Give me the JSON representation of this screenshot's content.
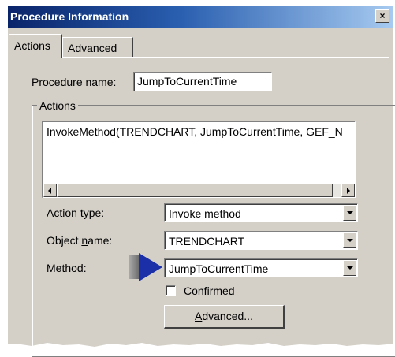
{
  "window": {
    "title": "Procedure Information",
    "close_label": "×"
  },
  "tabs": [
    {
      "label": "Actions",
      "selected": true
    },
    {
      "label": "Advanced",
      "selected": false
    }
  ],
  "procedure": {
    "name_label_prefix": "",
    "name_label_accel": "P",
    "name_label_rest": "rocedure name:",
    "name_value": "JumpToCurrentTime"
  },
  "actions_group": {
    "legend": "Actions",
    "list_items": [
      "InvokeMethod(TRENDCHART, JumpToCurrentTime, GEF_N"
    ]
  },
  "action_type": {
    "label_pre": "Action ",
    "label_accel": "t",
    "label_post": "ype:",
    "value": "Invoke method"
  },
  "object_name": {
    "label_pre": "Object ",
    "label_accel": "n",
    "label_post": "ame:",
    "value": "TRENDCHART"
  },
  "method": {
    "label_pre": "Met",
    "label_accel": "h",
    "label_post": "od:",
    "value": "JumpToCurrentTime"
  },
  "confirmed": {
    "label_pre": "Confi",
    "label_accel": "r",
    "label_post": "med",
    "checked": false
  },
  "advanced_button": {
    "label_pre": "",
    "label_accel": "A",
    "label_post": "dvanced..."
  },
  "colors": {
    "title_bar_start": "#0a246a",
    "title_bar_end": "#a6caf0",
    "dialog_face": "#d4d0c8",
    "pointer_arrow": "#1a2fa8"
  },
  "icons": {
    "close": "close-icon",
    "scroll_left": "scroll-left-arrow-icon",
    "scroll_right": "scroll-right-arrow-icon",
    "dropdown": "chevron-down-icon",
    "pointer": "pointer-arrow-icon"
  }
}
